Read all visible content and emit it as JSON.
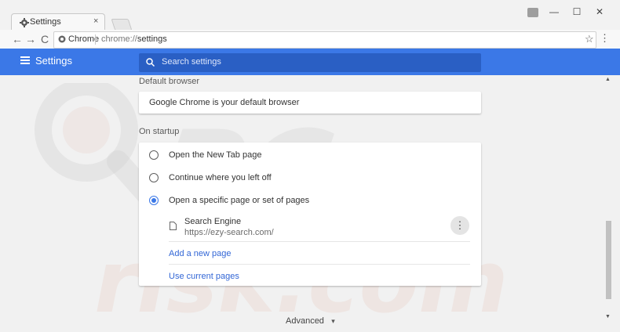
{
  "browser": {
    "tab_title": "Settings",
    "tab_close": "×",
    "omnibox_chip": "Chrome",
    "url_scheme": "chrome://",
    "url_path": "settings",
    "win_min": "—",
    "win_max": "☐",
    "win_close": "✕",
    "back": "←",
    "forward": "→",
    "reload": "C",
    "star": "☆",
    "menu": "⋮"
  },
  "header": {
    "title": "Settings",
    "search_placeholder": "Search settings"
  },
  "default_browser": {
    "section_title": "Default browser",
    "status": "Google Chrome is your default browser"
  },
  "on_startup": {
    "section_title": "On startup",
    "options": [
      {
        "label": "Open the New Tab page",
        "selected": false
      },
      {
        "label": "Continue where you left off",
        "selected": false
      },
      {
        "label": "Open a specific page or set of pages",
        "selected": true
      }
    ],
    "page_entry": {
      "name": "Search Engine",
      "url": "https://ezy-search.com/",
      "menu": "⋮"
    },
    "add_page": "Add a new page",
    "use_current": "Use current pages"
  },
  "footer": {
    "advanced": "Advanced",
    "advanced_arrow": "▾"
  },
  "scrollbar": {
    "up": "▲",
    "down": "▼"
  },
  "colors": {
    "accent": "#3b78e7",
    "link": "#3367d6"
  }
}
